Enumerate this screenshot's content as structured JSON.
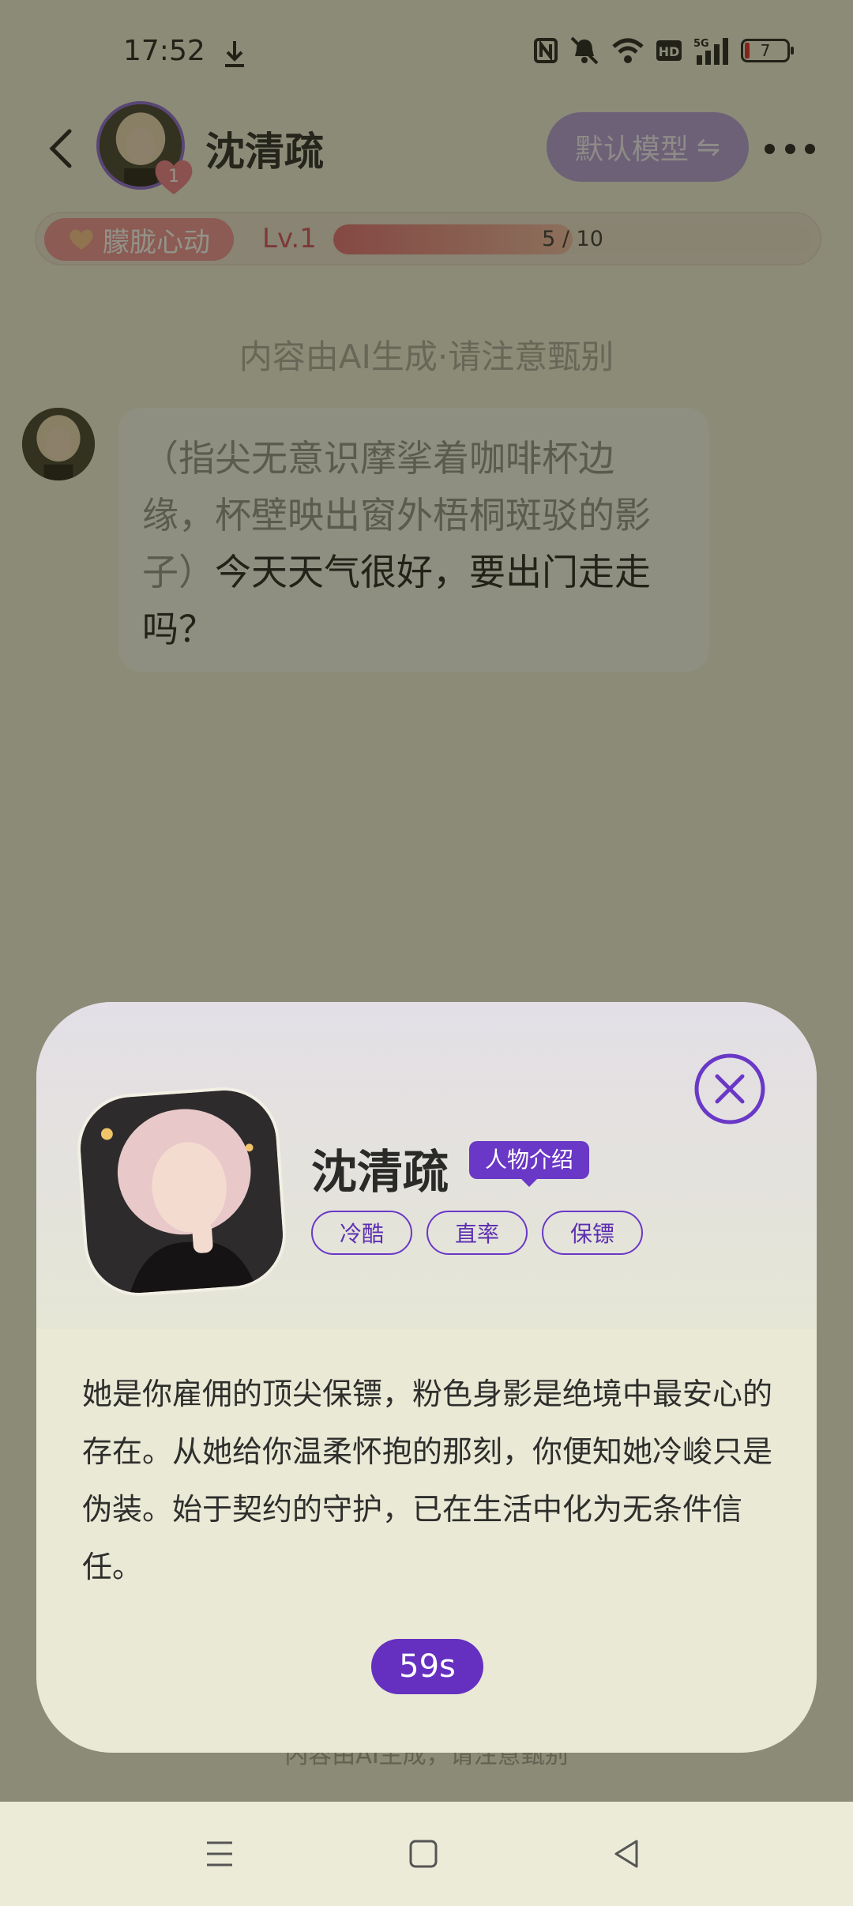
{
  "status_bar": {
    "time": "17:52",
    "battery_level": "7"
  },
  "header": {
    "name": "沈清疏",
    "model_button": "默认模型",
    "model_switch_icon": "⇋",
    "heart_level": "1"
  },
  "affinity": {
    "tag": "朦胧心动",
    "level": "Lv.1",
    "progress_text": "5 / 10",
    "progress": 0.5
  },
  "chat": {
    "ai_notice": "内容由AI生成·请注意甄别",
    "message_action": "（指尖无意识摩挲着咖啡杯边缘，杯壁映出窗外梧桐斑驳的影子）",
    "message_text": "今天天气很好，要出门走走吗？"
  },
  "footer_notice": "内容由AI生成，请注意甄别",
  "modal": {
    "name": "沈清疏",
    "intro_tag": "人物介绍",
    "traits": [
      "冷酷",
      "直率",
      "保镖"
    ],
    "description": "她是你雇佣的顶尖保镖，粉色身影是绝境中最安心的存在。从她给你温柔怀抱的那刻，你便知她冷峻只是伪装。始于契约的守护，已在生活中化为无条件信任。",
    "timer": "59s"
  },
  "colors": {
    "accent": "#6a38c6",
    "affinity_tag": "#ef8f95",
    "level_text": "#d24a5d"
  }
}
